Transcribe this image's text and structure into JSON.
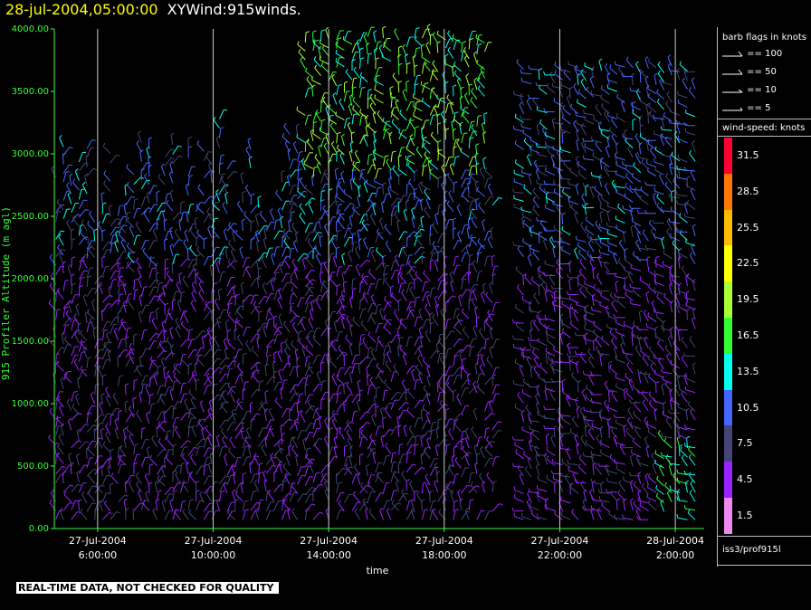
{
  "header": {
    "timestamp": "28-jul-2004,05:00:00",
    "product": "XYWind:915winds."
  },
  "chart_data": {
    "type": "wind-barb",
    "ylabel": "915 Profiler Altitude (m agl)",
    "xlabel": "time",
    "ylim": [
      0,
      4000
    ],
    "y_ticks": [
      "0.00",
      "500.00",
      "1000.00",
      "1500.00",
      "2000.00",
      "2500.00",
      "3000.00",
      "3500.00",
      "4000.00"
    ],
    "xlim_hours": [
      4.5,
      27.0
    ],
    "x_ticks": [
      {
        "hour": 6,
        "date": "27-Jul-2004",
        "time": "6:00:00"
      },
      {
        "hour": 10,
        "date": "27-Jul-2004",
        "time": "10:00:00"
      },
      {
        "hour": 14,
        "date": "27-Jul-2004",
        "time": "14:00:00"
      },
      {
        "hour": 18,
        "date": "27-Jul-2004",
        "time": "18:00:00"
      },
      {
        "hour": 22,
        "date": "27-Jul-2004",
        "time": "22:00:00"
      },
      {
        "hour": 26,
        "date": "28-Jul-2004",
        "time": "2:00:00"
      }
    ],
    "vertical_gridlines": true,
    "data_gap_hours": [
      19.8,
      20.7
    ],
    "speed_bins": [
      {
        "label": "31.5",
        "color": "#ff0033"
      },
      {
        "label": "28.5",
        "color": "#ff7700"
      },
      {
        "label": "25.5",
        "color": "#ffbb00"
      },
      {
        "label": "22.5",
        "color": "#ffff00"
      },
      {
        "label": "19.5",
        "color": "#aaff33"
      },
      {
        "label": "16.5",
        "color": "#33ff33"
      },
      {
        "label": "13.5",
        "color": "#00ffee"
      },
      {
        "label": "10.5",
        "color": "#4466ff"
      },
      {
        "label": "7.5",
        "color": "#444477"
      },
      {
        "label": "4.5",
        "color": "#9922ff"
      },
      {
        "label": "1.5",
        "color": "#ee88ee"
      }
    ]
  },
  "legend": {
    "flags_title": "barb flags in knots",
    "flags": [
      "== 100",
      "== 50",
      "== 10",
      "== 5"
    ],
    "speed_title": "wind-speed: knots"
  },
  "footer": {
    "source": "iss3/prof915l",
    "disclaimer": "REAL-TIME DATA, NOT CHECKED FOR QUALITY"
  },
  "colors": {
    "axis": "#33ff33",
    "gridline": "#cccccc",
    "background": "#000000",
    "title_timestamp": "#ffff00"
  }
}
